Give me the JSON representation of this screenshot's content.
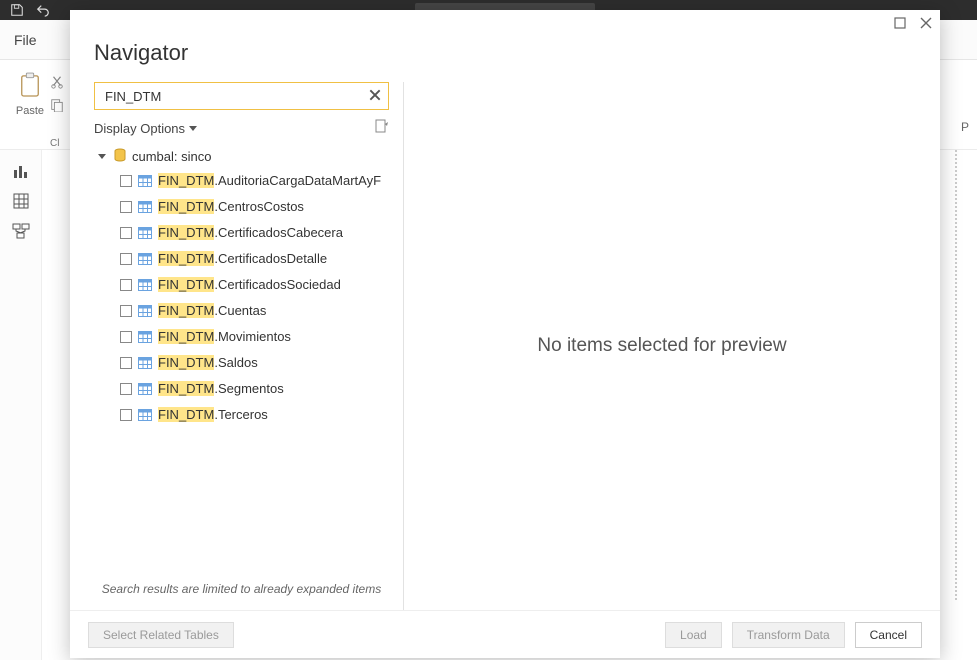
{
  "app": {
    "file_tab": "File",
    "paste_label": "Paste",
    "clipboard_group_short": "Cl",
    "right_pane_letter": "P"
  },
  "dialog": {
    "title": "Navigator",
    "search_value": "FIN_DTM",
    "display_options_label": "Display Options",
    "root_label": "cumbal: sinco",
    "items": [
      {
        "prefix": "FIN_DTM",
        "suffix": ".AuditoriaCargaDataMartAyF"
      },
      {
        "prefix": "FIN_DTM",
        "suffix": ".CentrosCostos"
      },
      {
        "prefix": "FIN_DTM",
        "suffix": ".CertificadosCabecera"
      },
      {
        "prefix": "FIN_DTM",
        "suffix": ".CertificadosDetalle"
      },
      {
        "prefix": "FIN_DTM",
        "suffix": ".CertificadosSociedad"
      },
      {
        "prefix": "FIN_DTM",
        "suffix": ".Cuentas"
      },
      {
        "prefix": "FIN_DTM",
        "suffix": ".Movimientos"
      },
      {
        "prefix": "FIN_DTM",
        "suffix": ".Saldos"
      },
      {
        "prefix": "FIN_DTM",
        "suffix": ".Segmentos"
      },
      {
        "prefix": "FIN_DTM",
        "suffix": ".Terceros"
      }
    ],
    "limit_note": "Search results are limited to already expanded items",
    "preview_empty": "No items selected for preview",
    "btn_select_related": "Select Related Tables",
    "btn_load": "Load",
    "btn_transform": "Transform Data",
    "btn_cancel": "Cancel"
  }
}
